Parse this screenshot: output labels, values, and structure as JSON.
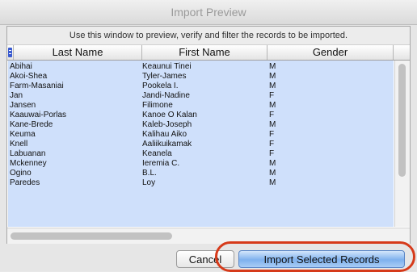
{
  "window": {
    "title": "Import Preview"
  },
  "instructions": "Use this window to preview, verify and filter the records to be imported.",
  "columns": {
    "last": "Last Name",
    "first": "First Name",
    "gender": "Gender"
  },
  "records": [
    {
      "last": "Abihai",
      "first": "Keaunui Tinei",
      "gender": "M"
    },
    {
      "last": "Akoi-Shea",
      "first": "Tyler-James",
      "gender": "M"
    },
    {
      "last": "Farm-Masaniai",
      "first": "Pookela I.",
      "gender": "M"
    },
    {
      "last": "Jan",
      "first": "Jandi-Nadine",
      "gender": "F"
    },
    {
      "last": "Jansen",
      "first": "Filimone",
      "gender": "M"
    },
    {
      "last": "Kaauwai-Porlas",
      "first": "Kanoe O Kalan",
      "gender": "F"
    },
    {
      "last": "Kane-Brede",
      "first": "Kaleb-Joseph",
      "gender": "M"
    },
    {
      "last": "Keuma",
      "first": "Kalihau Aiko",
      "gender": "F"
    },
    {
      "last": "Knell",
      "first": "Aaliikuikamak",
      "gender": "F"
    },
    {
      "last": "Labuanan",
      "first": "Keanela",
      "gender": "F"
    },
    {
      "last": "Mckenney",
      "first": "Ieremia C.",
      "gender": "M"
    },
    {
      "last": "Ogino",
      "first": "B.L.",
      "gender": "M"
    },
    {
      "last": "Paredes",
      "first": "Loy",
      "gender": "M"
    }
  ],
  "buttons": {
    "cancel": "Cancel",
    "import": "Import Selected Records"
  },
  "colors": {
    "selection": "#cfe0fb",
    "highlight": "#d63a1a"
  }
}
